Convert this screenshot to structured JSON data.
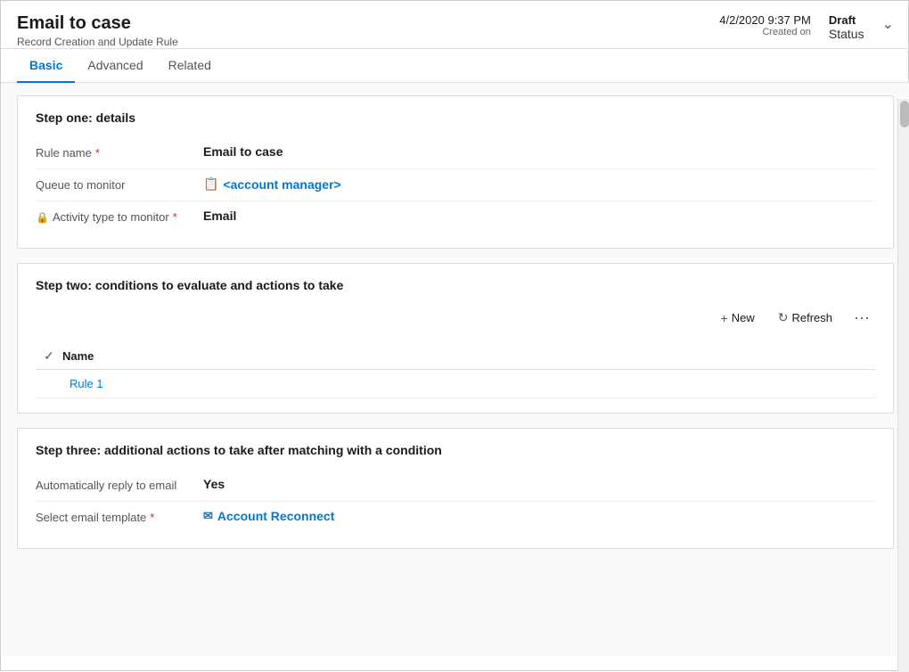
{
  "header": {
    "title": "Email to case",
    "subtitle": "Record Creation and Update Rule",
    "date": "4/2/2020 9:37 PM",
    "created_label": "Created on",
    "status_value": "Draft",
    "status_label": "Status"
  },
  "tabs": [
    {
      "id": "basic",
      "label": "Basic",
      "active": true
    },
    {
      "id": "advanced",
      "label": "Advanced",
      "active": false
    },
    {
      "id": "related",
      "label": "Related",
      "active": false
    }
  ],
  "step_one": {
    "title": "Step one: details",
    "fields": [
      {
        "label": "Rule name",
        "required": true,
        "locked": false,
        "value": "Email to case",
        "type": "text"
      },
      {
        "label": "Queue to monitor",
        "required": false,
        "locked": false,
        "value": "<account manager>",
        "type": "link",
        "icon": "queue"
      },
      {
        "label": "Activity type to monitor",
        "required": true,
        "locked": true,
        "value": "Email",
        "type": "text"
      }
    ]
  },
  "step_two": {
    "title": "Step two: conditions to evaluate and actions to take",
    "toolbar": {
      "new_label": "New",
      "refresh_label": "Refresh"
    },
    "table": {
      "header": "Name",
      "rows": [
        {
          "name": "Rule 1"
        }
      ]
    }
  },
  "step_three": {
    "title": "Step three: additional actions to take after matching with a condition",
    "fields": [
      {
        "label": "Automatically reply to email",
        "required": false,
        "locked": false,
        "value": "Yes",
        "type": "text"
      },
      {
        "label": "Select email template",
        "required": true,
        "locked": false,
        "value": "Account Reconnect",
        "type": "link",
        "icon": "email"
      }
    ]
  },
  "icons": {
    "plus": "+",
    "refresh": "↻",
    "more": "···",
    "check": "✓",
    "chevron_down": "⌄",
    "lock": "🔒",
    "queue": "📋",
    "email_template": "✉"
  }
}
